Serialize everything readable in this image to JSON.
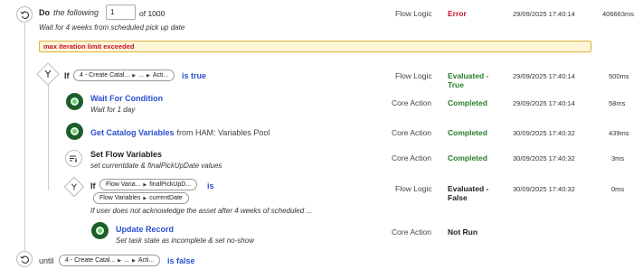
{
  "rows": {
    "do": {
      "title": "Do",
      "title_suffix": "the following",
      "iteration_value": "1",
      "iteration_total": "of 1000",
      "description": "Wait for 4 weeks from scheduled pick up date",
      "category": "Flow Logic",
      "status": "Error",
      "date": "29/09/2025 17:40:14",
      "duration": "406663ms",
      "error_message": "max iteration limit exceeded"
    },
    "if1": {
      "keyword": "If",
      "pill_a": "4 - Create Catal...",
      "pill_b": "...",
      "pill_c": "Acti...",
      "condition": "is true",
      "category": "Flow Logic",
      "status_line1": "Evaluated -",
      "status_line2": "True",
      "date": "29/09/2025 17:40:14",
      "duration": "500ms"
    },
    "wait": {
      "title": "Wait For Condition",
      "description": "Wait for 1 day",
      "category": "Core Action",
      "status": "Completed",
      "date": "29/09/2025 17:40:14",
      "duration": "58ms"
    },
    "catalog": {
      "title": "Get Catalog Variables",
      "from_text": "from HAM: Variables Pool",
      "category": "Core Action",
      "status": "Completed",
      "date": "30/09/2025 17:40:32",
      "duration": "439ms"
    },
    "setvars": {
      "title": "Set Flow Variables",
      "description": "set currentdate & finalPickUpDate values",
      "category": "Core Action",
      "status": "Completed",
      "date": "30/09/2025 17:40:32",
      "duration": "3ms"
    },
    "if2": {
      "keyword": "If",
      "pill_a": "Flow Varia...",
      "pill_b": "finalPickUpD...",
      "is_text": "is",
      "pill2_a": "Flow Variables",
      "pill2_b": "currentDate",
      "description": "If user does not acknowledge the asset after 4 weeks of scheduled ...",
      "category": "Flow Logic",
      "status_line1": "Evaluated -",
      "status_line2": "False",
      "date": "30/09/2025 17:40:32",
      "duration": "0ms"
    },
    "update": {
      "title": "Update Record",
      "description": "Set task state as incomplete & set no-show",
      "category": "Core Action",
      "status": "Not Run"
    },
    "until": {
      "keyword": "until",
      "pill_a": "4 - Create Catal...",
      "pill_b": "...",
      "pill_c": "Acti...",
      "condition": "is false"
    }
  },
  "colors": {
    "link": "#2b4fd1",
    "error": "#c8102e",
    "completed": "#2a7d2a",
    "banner_bg": "#fdf7d8",
    "banner_border": "#e0b23a"
  },
  "icons": {
    "do": "loop-icon",
    "if": "branch-icon",
    "action": "action-dot-icon",
    "set_vars": "set-variables-icon",
    "until": "loop-icon"
  }
}
